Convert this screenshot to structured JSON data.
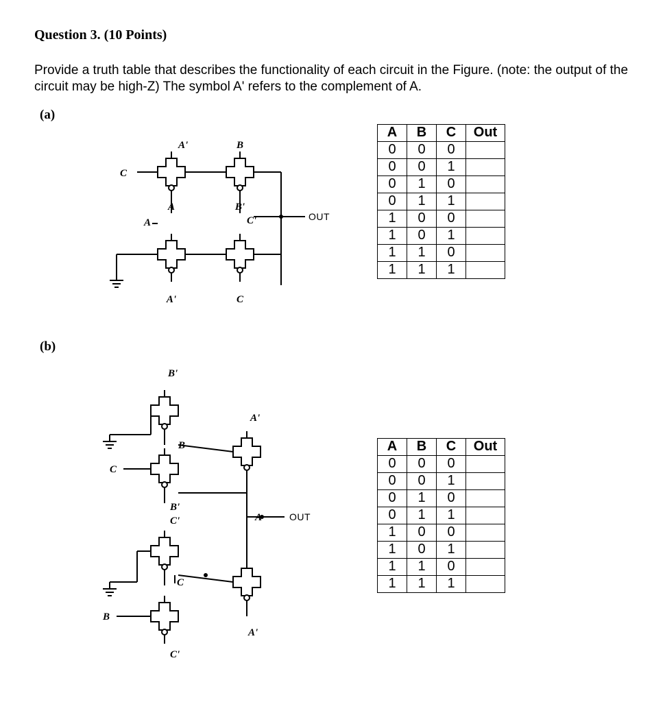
{
  "heading": "Question 3. (10 Points)",
  "instructions": "Provide a truth table that describes the functionality of each circuit in the Figure. (note: the output of the circuit may be high-Z) The symbol A' refers to the complement of A.",
  "parts": {
    "a": {
      "label": "(a)"
    },
    "b": {
      "label": "(b)"
    }
  },
  "circuit_labels": {
    "A": "A",
    "Aprime": "A'",
    "B": "B",
    "Bprime": "B'",
    "C": "C",
    "Cprime": "C'",
    "OUT": "OUT"
  },
  "truth_header": {
    "A": "A",
    "B": "B",
    "C": "C",
    "Out": "Out"
  },
  "truth_rows": [
    {
      "A": "0",
      "B": "0",
      "C": "0",
      "Out": ""
    },
    {
      "A": "0",
      "B": "0",
      "C": "1",
      "Out": ""
    },
    {
      "A": "0",
      "B": "1",
      "C": "0",
      "Out": ""
    },
    {
      "A": "0",
      "B": "1",
      "C": "1",
      "Out": ""
    },
    {
      "A": "1",
      "B": "0",
      "C": "0",
      "Out": ""
    },
    {
      "A": "1",
      "B": "0",
      "C": "1",
      "Out": ""
    },
    {
      "A": "1",
      "B": "1",
      "C": "0",
      "Out": ""
    },
    {
      "A": "1",
      "B": "1",
      "C": "1",
      "Out": ""
    }
  ]
}
